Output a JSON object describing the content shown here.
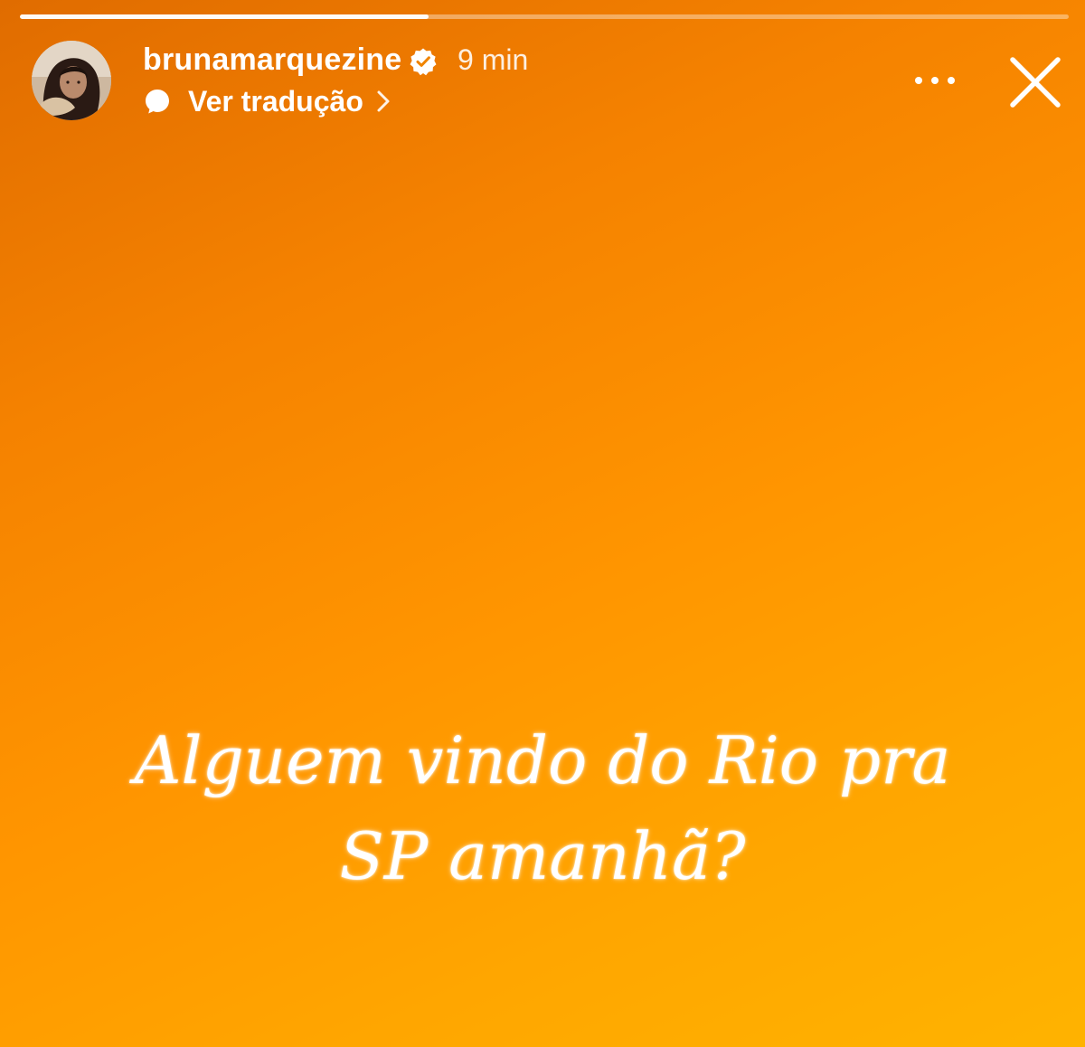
{
  "story": {
    "progress_fraction": 0.39,
    "background_colors": [
      "#e06c00",
      "#ff9500",
      "#ffb300"
    ]
  },
  "header": {
    "username": "brunamarquezine",
    "verified": true,
    "timestamp": "9 min",
    "translate_label": "Ver tradução",
    "icons": {
      "verified": "verified-badge-icon",
      "translate": "chat-bubble-icon",
      "chevron": "chevron-right-icon",
      "more": "more-horizontal-icon",
      "close": "close-icon"
    }
  },
  "caption": {
    "lines": [
      "Alguem vindo do Rio pra",
      "SP amanhã?"
    ]
  }
}
